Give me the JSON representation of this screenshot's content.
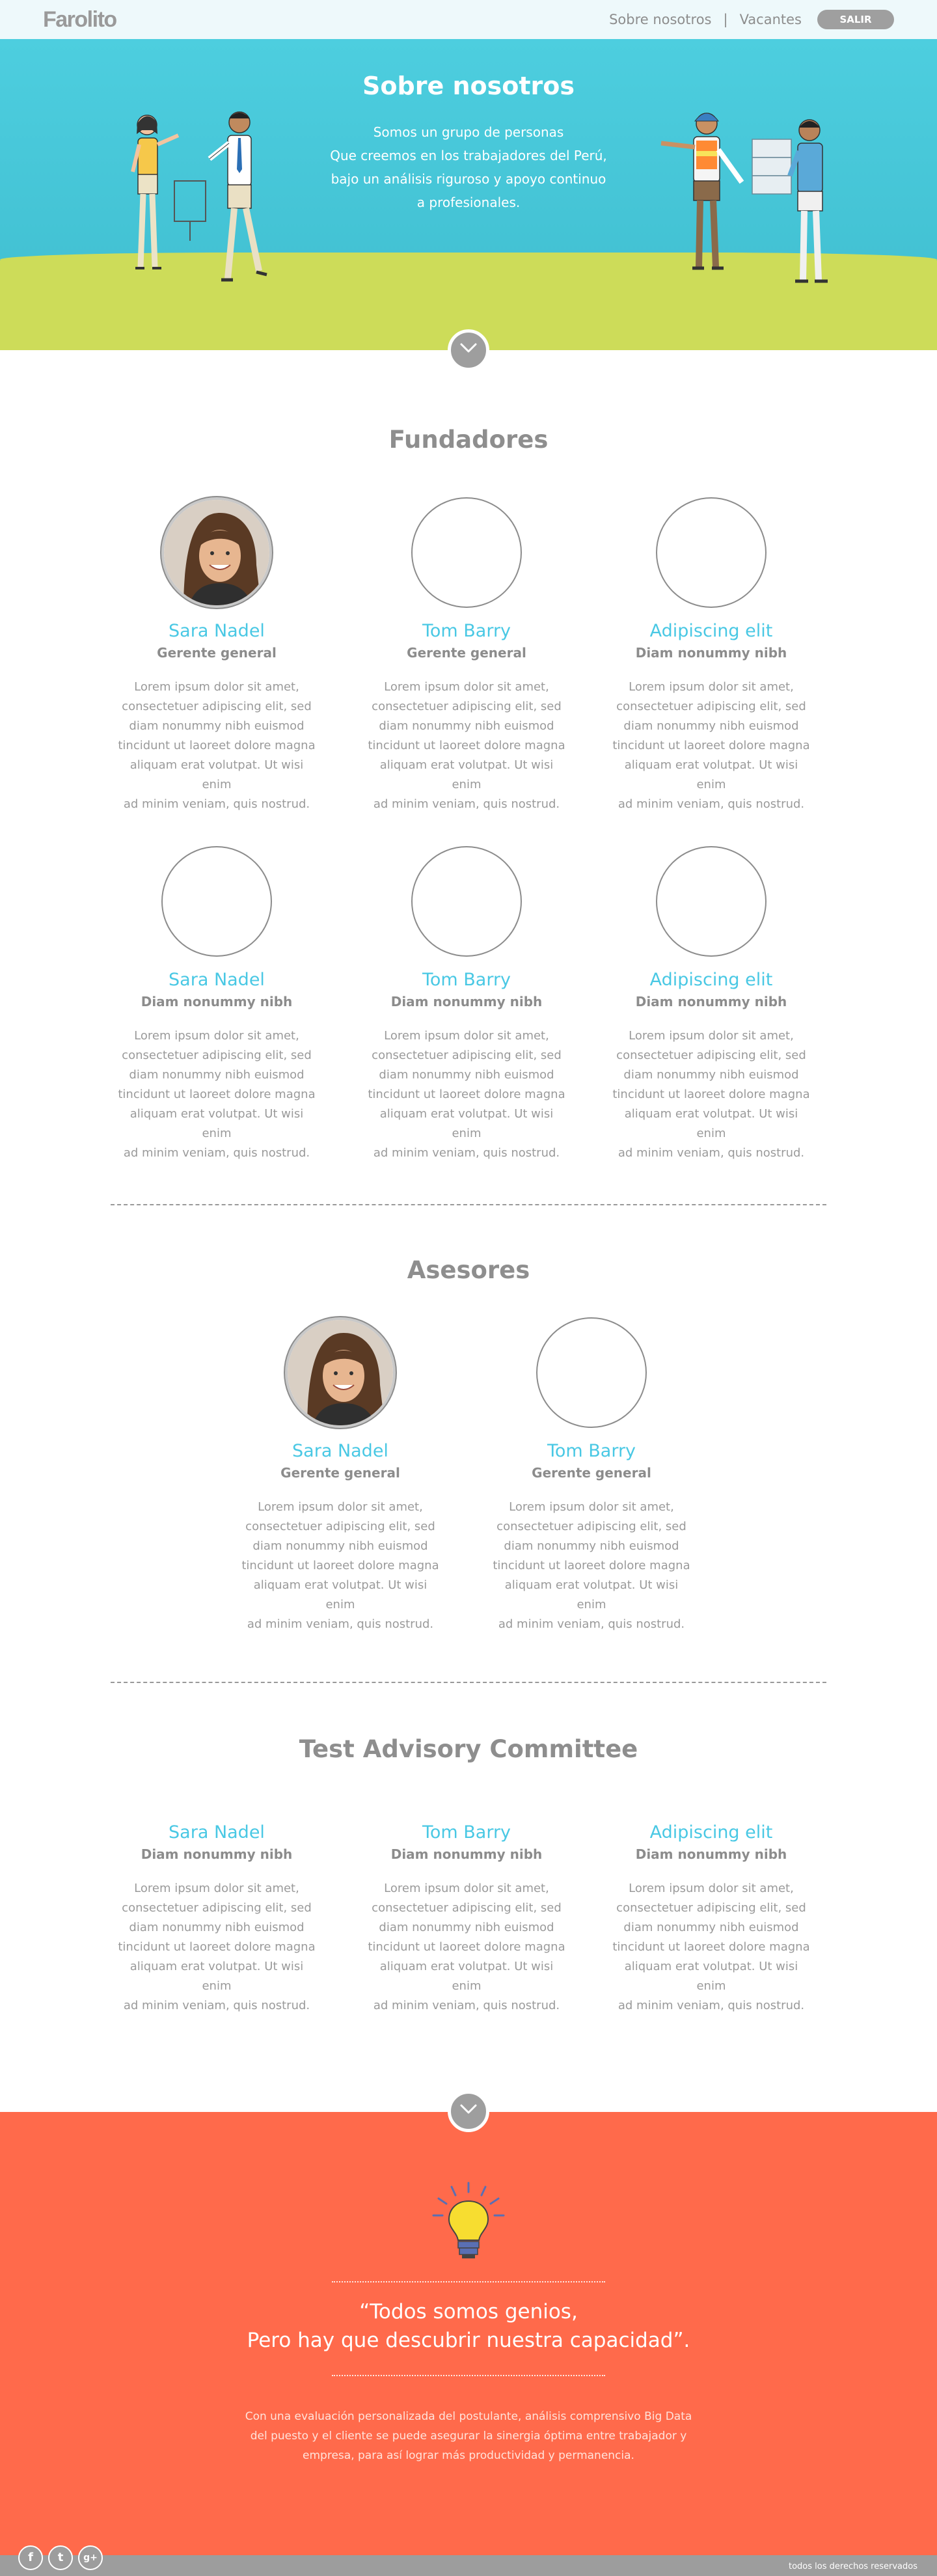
{
  "nav": {
    "logo": "Farolito",
    "links": [
      "Sobre nosotros",
      "Vacantes"
    ],
    "separator": "|",
    "logout": "SALIR"
  },
  "hero": {
    "title": "Sobre nosotros",
    "lines": [
      "Somos un grupo de personas",
      "Que creemos en los trabajadores del Perú,",
      "bajo un análisis riguroso y apoyo continuo",
      "a profesionales."
    ]
  },
  "founders": {
    "title": "Fundadores",
    "people": [
      {
        "name": "Sara Nadel",
        "role": "Gerente general",
        "photo": true
      },
      {
        "name": "Tom Barry",
        "role": "Gerente general",
        "photo": false
      },
      {
        "name": "Adipiscing elit",
        "role": "Diam nonummy nibh",
        "photo": false
      },
      {
        "name": "Sara Nadel",
        "role": "Diam nonummy nibh",
        "photo": false
      },
      {
        "name": "Tom Barry",
        "role": "Diam nonummy nibh",
        "photo": false
      },
      {
        "name": "Adipiscing elit",
        "role": "Diam nonummy nibh",
        "photo": false
      }
    ]
  },
  "advisors": {
    "title": "Asesores",
    "people": [
      {
        "name": "Sara Nadel",
        "role": "Gerente general",
        "photo": true
      },
      {
        "name": "Tom Barry",
        "role": "Gerente general",
        "photo": false
      }
    ]
  },
  "committee": {
    "title": "Test Advisory Committee",
    "people": [
      {
        "name": "Sara Nadel",
        "role": "Diam nonummy nibh"
      },
      {
        "name": "Tom Barry",
        "role": "Diam nonummy nibh"
      },
      {
        "name": "Adipiscing elit",
        "role": "Diam nonummy nibh"
      }
    ]
  },
  "lorem": [
    "Lorem ipsum dolor sit amet,",
    "consectetuer adipiscing elit, sed",
    "diam nonummy nibh euismod",
    "tincidunt ut laoreet dolore magna",
    "aliquam erat volutpat. Ut wisi enim",
    "ad minim veniam, quis nostrud."
  ],
  "quote": {
    "lines": [
      "“Todos somos genios,",
      "Pero hay que descubrir nuestra capacidad”."
    ]
  },
  "pitch": {
    "lines": [
      "Con una evaluación personalizada del postulante, análisis comprensivo Big Data",
      "del puesto y el cliente se puede asegurar la sinergia óptima entre trabajador y",
      "empresa, para así lograr más productividad y permanencia."
    ]
  },
  "footer": {
    "social": [
      {
        "icon": "facebook-icon",
        "glyph": "f"
      },
      {
        "icon": "twitter-icon",
        "glyph": "t"
      },
      {
        "icon": "google-plus-icon",
        "glyph": "g+"
      }
    ],
    "copyright": "todos los derechos reservados"
  },
  "colors": {
    "accent": "#49c8e4",
    "hero_sky": "#4dcedf",
    "hero_grass": "#cddc59",
    "band": "#ff6a4b",
    "footer": "#9d9d9d"
  }
}
